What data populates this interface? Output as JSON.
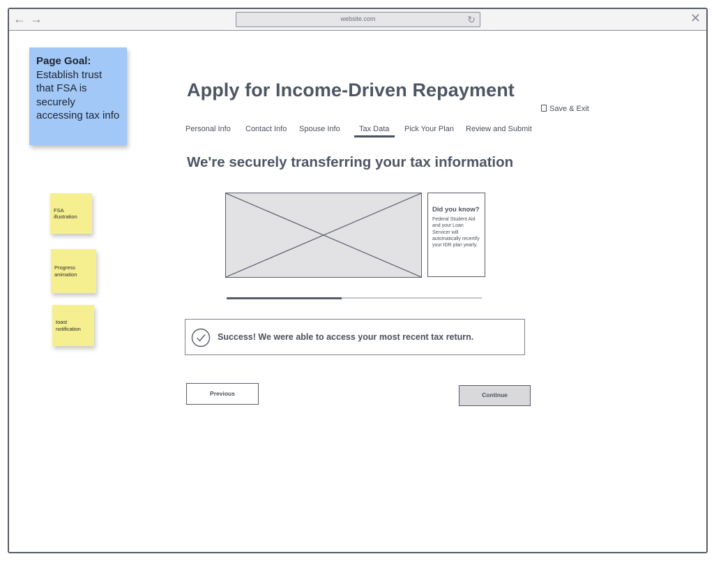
{
  "browser": {
    "url": "website.com",
    "back_icon": "←",
    "forward_icon": "→",
    "reload_icon": "↻",
    "close_icon": "✕"
  },
  "sticky_notes": {
    "page_goal": {
      "label": "Page Goal:",
      "text": "Establish trust that FSA is securely accessing tax info",
      "color": "#a1c8f7"
    },
    "yellow_color": "#f5ef8f",
    "annotations": [
      "FSA illustration",
      "Progress animation",
      "toast notification"
    ]
  },
  "header": {
    "title": "Apply for Income-Driven Repayment",
    "save_exit": "Save & Exit"
  },
  "tabs": [
    {
      "label": "Personal Info",
      "active": false
    },
    {
      "label": "Contact Info",
      "active": false
    },
    {
      "label": "Spouse Info",
      "active": false
    },
    {
      "label": "Tax Data",
      "active": true
    },
    {
      "label": "Pick Your Plan",
      "active": false
    },
    {
      "label": "Review and Submit",
      "active": false
    }
  ],
  "main": {
    "subtitle": "We're securely transferring your tax information",
    "did_you_know": {
      "title": "Did you know?",
      "body": "Federal Student Aid and your Loan Servicer will automatically recertify your IDR plan yearly."
    },
    "progress_fraction": 0.45,
    "toast": {
      "message": "Success! We were able to access your most recent tax return."
    }
  },
  "buttons": {
    "previous": "Previous",
    "continue": "Continue"
  }
}
